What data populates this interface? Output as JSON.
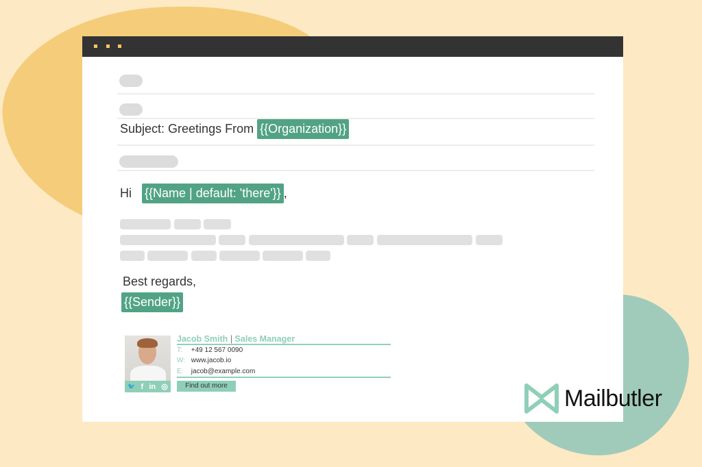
{
  "titlebar": {
    "dots": [
      "window-dot",
      "window-dot",
      "window-dot"
    ]
  },
  "email": {
    "subject_prefix": "Subject: Greetings From",
    "subject_tag": "{{Organization}}",
    "greeting": "Hi",
    "name_tag": "{{Name | default: 'there'}}",
    "greeting_suffix": ",",
    "closing": "Best regards,",
    "sender_tag": "{{Sender}}"
  },
  "signature": {
    "name": "Jacob Smith",
    "separator": "|",
    "title": "Sales Manager",
    "phone_label": "T:",
    "phone": "+49 12 567 0090",
    "web_label": "W:",
    "web": "www.jacob.io",
    "email_label": "E:",
    "email": "jacob@example.com",
    "social_icons": [
      "twitter-icon",
      "facebook-icon",
      "linkedin-icon",
      "instagram-icon"
    ],
    "social_glyphs": [
      "🐦",
      "f",
      "in",
      "◎"
    ],
    "cta": "Find out more"
  },
  "brand": {
    "name": "Mailbutler",
    "accent": "#52a386",
    "signature_color": "#8fcfb8"
  }
}
